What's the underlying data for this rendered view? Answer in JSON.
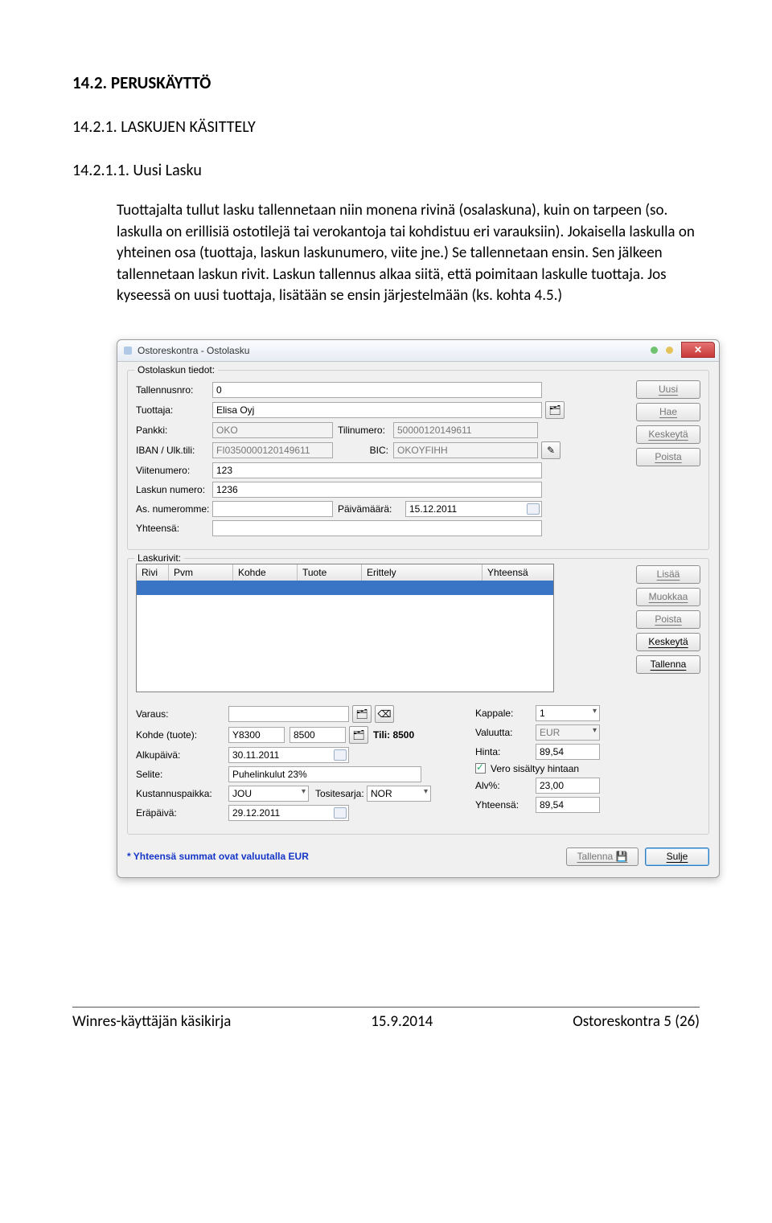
{
  "doc": {
    "h1": "14.2. PERUSKÄYTTÖ",
    "h2": "14.2.1. LASKUJEN KÄSITTELY",
    "h3": "14.2.1.1. Uusi Lasku",
    "para": "Tuottajalta tullut lasku tallennetaan niin monena rivinä (osalaskuna), kuin on tarpeen (so. laskulla on erillisiä ostotilejä tai verokantoja tai kohdistuu eri varauksiin). Jokaisella laskulla on yhteinen osa (tuottaja, laskun laskunumero, viite jne.) Se tallennetaan ensin. Sen jälkeen tallennetaan laskun rivit. Laskun tallennus alkaa siitä, että poimitaan laskulle tuottaja. Jos kyseessä on uusi tuottaja, lisätään se ensin järjestelmään (ks. kohta 4.5.)"
  },
  "win": {
    "title": "Ostoreskontra - Ostolasku",
    "group1": "Ostolaskun tiedot:",
    "group2": "Laskurivit:",
    "labels": {
      "tallennusnro": "Tallennusnro:",
      "tuottaja": "Tuottaja:",
      "pankki": "Pankki:",
      "tilinumero": "Tilinumero:",
      "ibanulk": "IBAN / Ulk.tili:",
      "bic": "BIC:",
      "viitenumero": "Viitenumero:",
      "laskunnumero": "Laskun numero:",
      "asnumeromme": "As. numeromme:",
      "paivamaara": "Päivämäärä:",
      "yhteensa": "Yhteensä:",
      "varaus": "Varaus:",
      "kohde": "Kohde (tuote):",
      "alkupaiva": "Alkupäivä:",
      "selite": "Selite:",
      "kustannuspaikka": "Kustannuspaikka:",
      "erapaiva": "Eräpäivä:",
      "tositesarja": "Tositesarja:",
      "tililbl": "Tili: 8500",
      "kappale": "Kappale:",
      "valuutta": "Valuutta:",
      "hinta": "Hinta:",
      "verosis": "Vero sisältyy hintaan",
      "alv": "Alv%:",
      "yhteensa2": "Yhteensä:"
    },
    "values": {
      "tallennusnro": "0",
      "tuottaja": "Elisa Oyj",
      "pankki": "OKO",
      "tilinumero": "50000120149611",
      "iban": "FI0350000120149611",
      "bic": "OKOYFIHH",
      "viitenumero": "123",
      "laskunnumero": "1236",
      "asnumeromme": "",
      "paivamaara": "15.12.2011",
      "yhteensa": "",
      "varaus": "",
      "kohde1": "Y8300",
      "kohde2": "8500",
      "alkupaiva": "30.11.2011",
      "selite": "Puhelinkulut 23%",
      "kustannuspaikka": "JOU",
      "tositesarja": "NOR",
      "erapaiva": "29.12.2011",
      "kappale": "1",
      "valuutta": "EUR",
      "hinta": "89,54",
      "alv": "23,00",
      "yhteensa2": "89,54"
    },
    "buttons": {
      "uusi": "Uusi",
      "hae": "Hae",
      "keskeyta": "Keskeytä",
      "poista": "Poista",
      "lisaa": "Lisää",
      "muokkaa": "Muokkaa",
      "poista2": "Poista",
      "keskeyta2": "Keskeytä",
      "tallenna": "Tallenna",
      "tallenna2": "Tallenna",
      "sulje": "Sulje"
    },
    "cols": {
      "rivi": "Rivi",
      "pvm": "Pvm",
      "kohde": "Kohde",
      "tuote": "Tuote",
      "erittely": "Erittely",
      "yhteensa": "Yhteensä"
    },
    "note": "* Yhteensä summat ovat valuutalla EUR"
  },
  "footer": {
    "left": "Winres-käyttäjän käsikirja",
    "mid": "15.9.2014",
    "right": "Ostoreskontra 5 (26)"
  }
}
